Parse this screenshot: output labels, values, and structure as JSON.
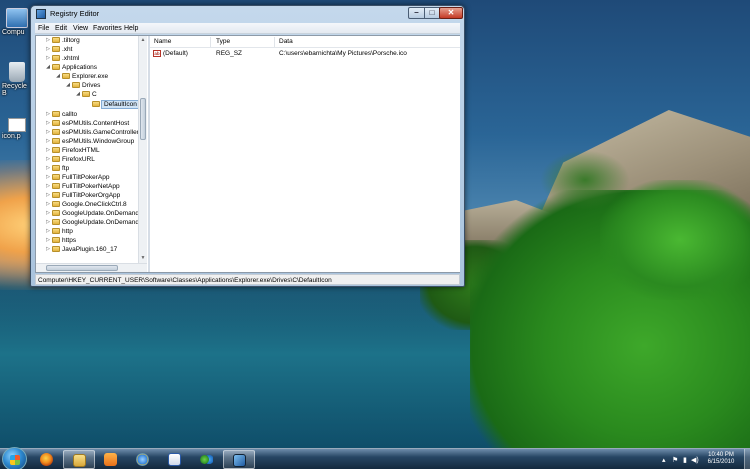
{
  "desktop": {
    "icons": [
      {
        "label": "Compu"
      },
      {
        "label": "Recycle B"
      },
      {
        "label": "icon.p"
      }
    ]
  },
  "window": {
    "title": "Registry Editor",
    "buttons": {
      "minimize": "–",
      "maximize": "□",
      "close": "✕"
    },
    "menu": [
      "File",
      "Edit",
      "View",
      "Favorites",
      "Help"
    ],
    "tree": [
      {
        "label": ".tiltorg",
        "expander": "▷"
      },
      {
        "label": ".xht",
        "expander": "▷"
      },
      {
        "label": ".xhtml",
        "expander": "▷"
      },
      {
        "label": "Applications",
        "expander": "◢"
      },
      {
        "label": "Explorer.exe",
        "expander": "◢"
      },
      {
        "label": "Drives",
        "expander": "◢"
      },
      {
        "label": "C",
        "expander": "◢"
      },
      {
        "label": "DefaultIcon",
        "expander": ""
      },
      {
        "label": "callto",
        "expander": "▷"
      },
      {
        "label": "esPMUtils.ContentHost",
        "expander": "▷"
      },
      {
        "label": "esPMUtils.GameController",
        "expander": "▷"
      },
      {
        "label": "esPMUtils.WindowGroup",
        "expander": "▷"
      },
      {
        "label": "FirefoxHTML",
        "expander": "▷"
      },
      {
        "label": "FirefoxURL",
        "expander": "▷"
      },
      {
        "label": "ftp",
        "expander": "▷"
      },
      {
        "label": "FullTiltPokerApp",
        "expander": "▷"
      },
      {
        "label": "FullTiltPokerNetApp",
        "expander": "▷"
      },
      {
        "label": "FullTiltPokerOrgApp",
        "expander": "▷"
      },
      {
        "label": "Google.OneClickCtrl.8",
        "expander": "▷"
      },
      {
        "label": "GoogleUpdate.OnDemandC",
        "expander": "▷"
      },
      {
        "label": "GoogleUpdate.OnDemandC",
        "expander": "▷"
      },
      {
        "label": "http",
        "expander": "▷"
      },
      {
        "label": "https",
        "expander": "▷"
      },
      {
        "label": "JavaPlugin.160_17",
        "expander": "▷"
      }
    ],
    "list": {
      "columns": [
        "Name",
        "Type",
        "Data"
      ],
      "rows": [
        {
          "icon_text": "ab",
          "name": "(Default)",
          "type": "REG_SZ",
          "data": "C:\\users\\ebarnichta\\My Pictures\\Porsche.ico"
        }
      ]
    },
    "status": "Computer\\HKEY_CURRENT_USER\\Software\\Classes\\Applications\\Explorer.exe\\Drives\\C\\DefaultIcon"
  },
  "taskbar": {
    "apps": [
      "firefox",
      "windows-explorer",
      "media-player",
      "internet-explorer",
      "word",
      "messenger",
      "registry-editor"
    ],
    "tray": {
      "arrow": "▴",
      "flag": "⚑",
      "volume": "◀)"
    },
    "clock": {
      "time": "10:40 PM",
      "date": "6/15/2010"
    }
  },
  "colors": {
    "accent": "#3a7bd5",
    "selection": "#cfe3f6",
    "close": "#c43a26"
  }
}
